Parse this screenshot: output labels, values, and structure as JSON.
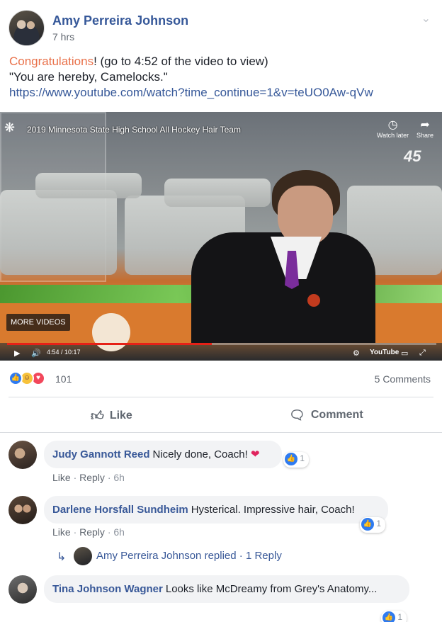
{
  "post": {
    "author": "Amy Perreira Johnson",
    "time": "7 hrs",
    "text_highlight": "Congratulations",
    "text_line1_rest": "! (go to 4:52 of the video to view)",
    "text_line2": "\"You are hereby, Camelocks.\"",
    "link": "https://www.youtube.com/watch?time_continue=1&v=teUO0Aw-qVw"
  },
  "video": {
    "title": "2019 Minnesota State High School All Hockey Hair Team",
    "watch_later": "Watch later",
    "share": "Share",
    "channel_mark": "45",
    "more_videos": "MORE VIDEOS",
    "current_time": "4:54",
    "duration": "10:17",
    "time_display": "4:54 / 10:17",
    "progress_fraction": 0.477,
    "youtube_label": "YouTube"
  },
  "stats": {
    "reaction_count": "101",
    "comments_label": "5 Comments",
    "reaction_icons": [
      "like-icon",
      "haha-icon",
      "love-icon"
    ]
  },
  "actions": {
    "like_label": "Like",
    "comment_label": "Comment"
  },
  "comments": [
    {
      "name": "Judy Gannott Reed",
      "text": "Nicely done, Coach!",
      "emoji": "❤",
      "reactions": "1",
      "like": "Like",
      "reply": "Reply",
      "time": "6h"
    },
    {
      "name": "Darlene Horsfall Sundheim",
      "text": "Hysterical. Impressive hair, Coach!",
      "reactions": "1",
      "like": "Like",
      "reply": "Reply",
      "time": "6h"
    },
    {
      "name": "Tina Johnson Wagner",
      "text": "Looks like McDreamy from Grey's Anatomy...",
      "reactions": "1"
    }
  ],
  "reply_summary": {
    "replier": "Amy Perreira Johnson",
    "replied_text": "replied",
    "count_label": "1 Reply"
  },
  "colors": {
    "link_blue": "#365899",
    "highlight_orange": "#e9714a",
    "progress_red": "#e62117",
    "like_blue": "#2f7bf0"
  }
}
